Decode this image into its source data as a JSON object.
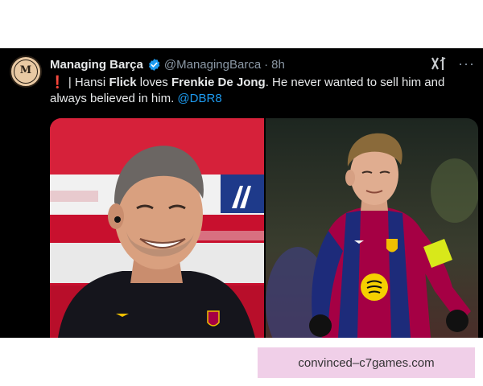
{
  "tweet": {
    "avatar_monogram": "M",
    "display_name": "Managing Barça",
    "handle": "@ManagingBarca",
    "separator": "·",
    "time": "8h",
    "text_part1": " | Hansi ",
    "text_bold1": "Flick",
    "text_part2": " loves ",
    "text_bold2": "Frenkie De Jong",
    "text_part3": ". He never wanted to sell him and always believed in him. ",
    "mention": "@DBR8",
    "more_label": "···",
    "grok_label": "x̸"
  },
  "watermark": {
    "text": "convinced–c7games.com"
  },
  "colors": {
    "background": "#000000",
    "text": "#e7e9ea",
    "muted": "#8b98a5",
    "link": "#1d9bf0",
    "verified": "#1d9bf0",
    "alert": "#e0245e",
    "watermark_bg": "#f0cfe8"
  },
  "icons": {
    "verified": "verified-badge-icon",
    "alert": "exclamation-icon",
    "grok": "grok-icon",
    "more": "more-icon"
  }
}
